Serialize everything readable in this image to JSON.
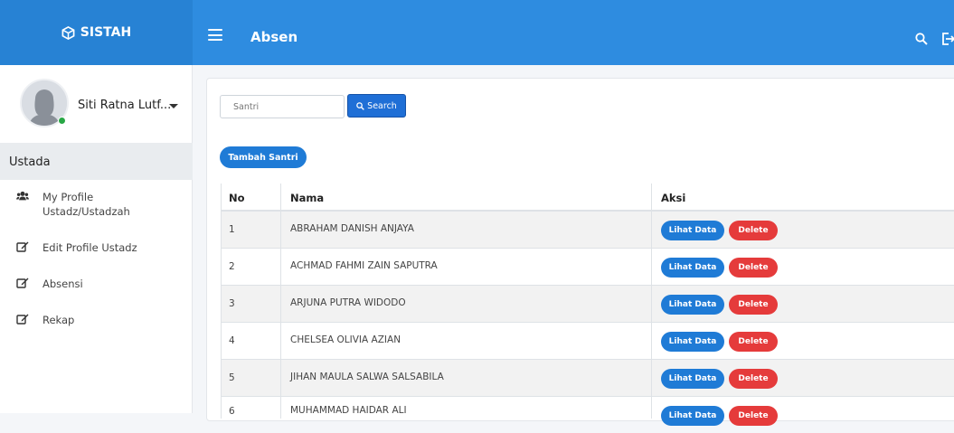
{
  "app": {
    "brand": "SISTAH",
    "page_title": "Absen",
    "accent": "#2e8ce0"
  },
  "user": {
    "name": "Siti Ratna Lutf..."
  },
  "sidebar": {
    "section": "Ustada",
    "items": [
      {
        "label": "My Profile Ustadz/Ustadzah",
        "icon": "users-icon"
      },
      {
        "label": "Edit Profile Ustadz",
        "icon": "edit-icon"
      },
      {
        "label": "Absensi",
        "icon": "edit-icon"
      },
      {
        "label": "Rekap",
        "icon": "edit-icon"
      }
    ]
  },
  "search": {
    "placeholder": "Santri",
    "button_label": "Search"
  },
  "add_button": "Tambah Santri",
  "table": {
    "headers": [
      "No",
      "Nama",
      "Aksi"
    ],
    "view_label": "Lihat Data",
    "delete_label": "Delete",
    "rows": [
      {
        "no": "1",
        "nama": "ABRAHAM DANISH ANJAYA"
      },
      {
        "no": "2",
        "nama": "ACHMAD FAHMI ZAIN SAPUTRA"
      },
      {
        "no": "3",
        "nama": "ARJUNA PUTRA WIDODO"
      },
      {
        "no": "4",
        "nama": "CHELSEA OLIVIA AZIAN"
      },
      {
        "no": "5",
        "nama": "JIHAN MAULA SALWA SALSABILA"
      },
      {
        "no": "6",
        "nama": "MUHAMMAD HAIDAR ALI"
      }
    ]
  }
}
